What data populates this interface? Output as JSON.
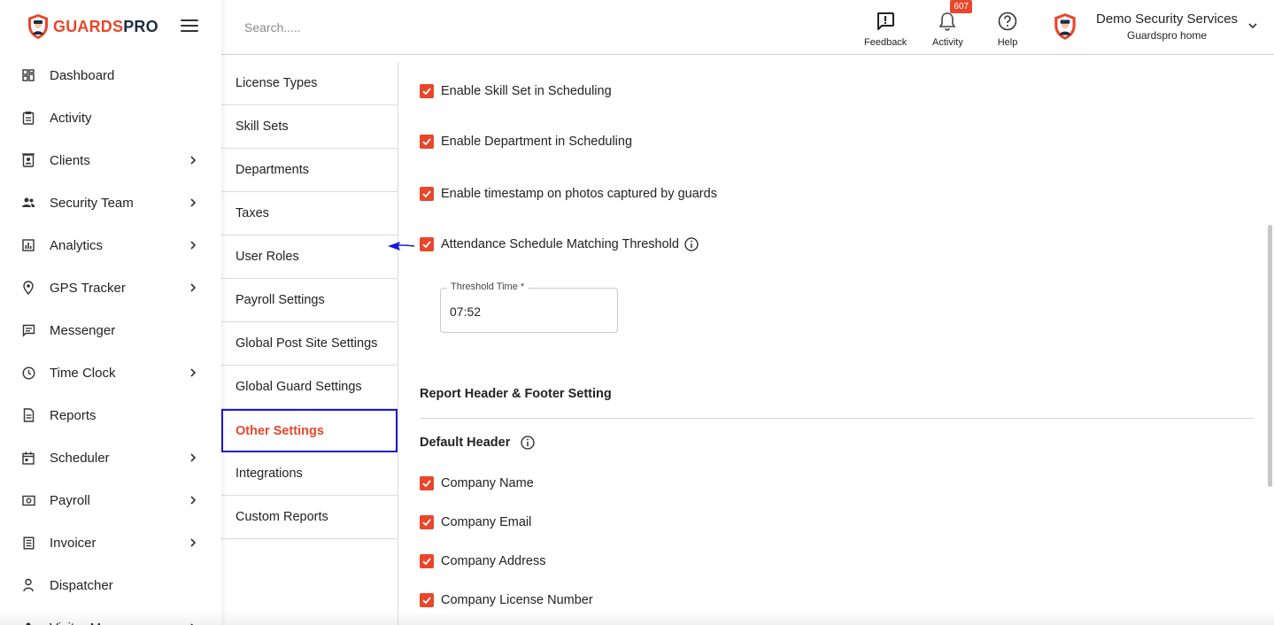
{
  "brand": {
    "name_part1": "GUARDS",
    "name_part2": "PRO",
    "accent": "#e8472b",
    "dark": "#1f2a44"
  },
  "sidebar": {
    "items": [
      {
        "label": "Dashboard",
        "icon": "dashboard-icon",
        "has_children": false
      },
      {
        "label": "Activity",
        "icon": "clipboard-icon",
        "has_children": false
      },
      {
        "label": "Clients",
        "icon": "contacts-icon",
        "has_children": true
      },
      {
        "label": "Security Team",
        "icon": "team-icon",
        "has_children": true
      },
      {
        "label": "Analytics",
        "icon": "analytics-icon",
        "has_children": true
      },
      {
        "label": "GPS Tracker",
        "icon": "location-pin-icon",
        "has_children": true
      },
      {
        "label": "Messenger",
        "icon": "message-icon",
        "has_children": false
      },
      {
        "label": "Time Clock",
        "icon": "clock-icon",
        "has_children": true
      },
      {
        "label": "Reports",
        "icon": "report-icon",
        "has_children": false
      },
      {
        "label": "Scheduler",
        "icon": "calendar-icon",
        "has_children": true
      },
      {
        "label": "Payroll",
        "icon": "money-icon",
        "has_children": true
      },
      {
        "label": "Invoicer",
        "icon": "invoice-icon",
        "has_children": true
      },
      {
        "label": "Dispatcher",
        "icon": "dispatcher-icon",
        "has_children": false
      },
      {
        "label": "Visitor M...",
        "icon": "visitor-icon",
        "has_children": true
      }
    ]
  },
  "topbar": {
    "search_placeholder": "Search.....",
    "feedback_label": "Feedback",
    "activity_label": "Activity",
    "activity_badge": "607",
    "help_label": "Help",
    "profile_name": "Demo Security Services",
    "profile_sub": "Guardspro home"
  },
  "settings_menu": {
    "items": [
      "License Types",
      "Skill Sets",
      "Departments",
      "Taxes",
      "User Roles",
      "Payroll Settings",
      "Global Post Site Settings",
      "Global Guard Settings",
      "Other Settings",
      "Integrations",
      "Custom Reports"
    ],
    "active": "Other Settings"
  },
  "main": {
    "options": [
      {
        "label": "Enable Skill Set in Scheduling",
        "checked": true
      },
      {
        "label": "Enable Department in Scheduling",
        "checked": true
      },
      {
        "label": "Enable timestamp on photos captured by guards",
        "checked": true
      },
      {
        "label": "Attendance Schedule Matching Threshold",
        "checked": true
      }
    ],
    "threshold_label": "Threshold Time *",
    "threshold_value": "07:52",
    "report_section_title": "Report Header & Footer Setting",
    "default_header_title": "Default Header",
    "header_options": [
      {
        "label": "Company Name",
        "checked": true
      },
      {
        "label": "Company Email",
        "checked": true
      },
      {
        "label": "Company Address",
        "checked": true
      },
      {
        "label": "Company License Number",
        "checked": true
      }
    ]
  }
}
